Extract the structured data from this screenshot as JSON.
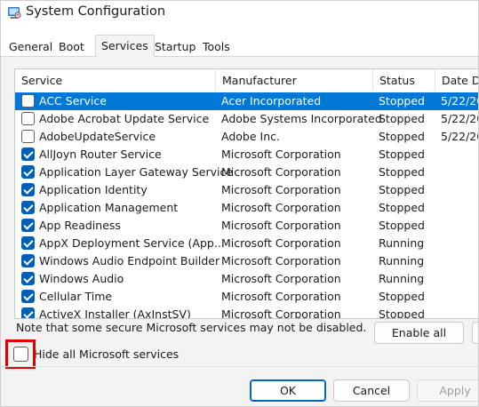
{
  "window": {
    "title": "System Configuration",
    "icon": "system-config-icon"
  },
  "tabs": [
    {
      "label": "General",
      "active": false
    },
    {
      "label": "Boot",
      "active": false
    },
    {
      "label": "Services",
      "active": true
    },
    {
      "label": "Startup",
      "active": false
    },
    {
      "label": "Tools",
      "active": false
    }
  ],
  "columns": {
    "service": "Service",
    "manufacturer": "Manufacturer",
    "status": "Status",
    "date": "Date D"
  },
  "rows": [
    {
      "service": "ACC Service",
      "manufacturer": "Acer Incorporated",
      "status": "Stopped",
      "date": "5/22/20",
      "checked": false,
      "selected": true
    },
    {
      "service": "Adobe Acrobat Update Service",
      "manufacturer": "Adobe Systems Incorporated",
      "status": "Stopped",
      "date": "5/22/20",
      "checked": false,
      "selected": false
    },
    {
      "service": "AdobeUpdateService",
      "manufacturer": "Adobe Inc.",
      "status": "Stopped",
      "date": "5/22/20",
      "checked": false,
      "selected": false
    },
    {
      "service": "AllJoyn Router Service",
      "manufacturer": "Microsoft Corporation",
      "status": "Stopped",
      "date": "",
      "checked": true,
      "selected": false
    },
    {
      "service": "Application Layer Gateway Service",
      "manufacturer": "Microsoft Corporation",
      "status": "Stopped",
      "date": "",
      "checked": true,
      "selected": false
    },
    {
      "service": "Application Identity",
      "manufacturer": "Microsoft Corporation",
      "status": "Stopped",
      "date": "",
      "checked": true,
      "selected": false
    },
    {
      "service": "Application Management",
      "manufacturer": "Microsoft Corporation",
      "status": "Stopped",
      "date": "",
      "checked": true,
      "selected": false
    },
    {
      "service": "App Readiness",
      "manufacturer": "Microsoft Corporation",
      "status": "Stopped",
      "date": "",
      "checked": true,
      "selected": false
    },
    {
      "service": "AppX Deployment Service (App...",
      "manufacturer": "Microsoft Corporation",
      "status": "Running",
      "date": "",
      "checked": true,
      "selected": false
    },
    {
      "service": "Windows Audio Endpoint Builder",
      "manufacturer": "Microsoft Corporation",
      "status": "Running",
      "date": "",
      "checked": true,
      "selected": false
    },
    {
      "service": "Windows Audio",
      "manufacturer": "Microsoft Corporation",
      "status": "Running",
      "date": "",
      "checked": true,
      "selected": false
    },
    {
      "service": "Cellular Time",
      "manufacturer": "Microsoft Corporation",
      "status": "Stopped",
      "date": "",
      "checked": true,
      "selected": false
    },
    {
      "service": "ActiveX Installer (AxInstSV)",
      "manufacturer": "Microsoft Corporation",
      "status": "Stopped",
      "date": "",
      "checked": true,
      "selected": false
    }
  ],
  "note": "Note that some secure Microsoft services may not be disabled.",
  "buttons": {
    "enable_all": "Enable all",
    "ok": "OK",
    "cancel": "Cancel",
    "apply": "Apply"
  },
  "hide_ms": {
    "label": "Hide all Microsoft services",
    "checked": false
  },
  "colors": {
    "selection": "#0078d7",
    "checkbox": "#005fb8",
    "highlight": "#e00000"
  }
}
